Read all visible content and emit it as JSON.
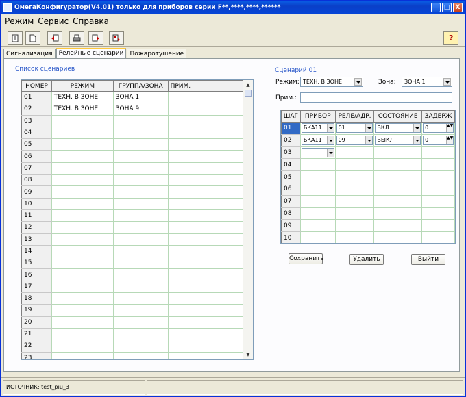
{
  "window": {
    "title": "ОмегаКонфигуратор(V4.01) только для приборов серии F**,****,****,******",
    "min_label": "_",
    "max_label": "□",
    "close_label": "X"
  },
  "menu": {
    "items": [
      "Режим",
      "Сервис",
      "Справка"
    ]
  },
  "toolbar": {
    "icons": [
      "new-doc-icon",
      "open-doc-icon",
      "import-icon",
      "print-icon",
      "export-icon",
      "export-alt-icon",
      "help-icon"
    ],
    "help_label": "?"
  },
  "tabs": [
    "Сигнализация",
    "Релейные сценарии",
    "Пожаротушение"
  ],
  "scenario_list": {
    "title": "Список сценариев",
    "columns": [
      "НОМЕР",
      "РЕЖИМ",
      "ГРУППА/ЗОНА",
      "ПРИМ."
    ],
    "rows": [
      [
        "01",
        "ТЕХН. В ЗОНЕ",
        "ЗОНА 1",
        ""
      ],
      [
        "02",
        "ТЕХН. В ЗОНЕ",
        "ЗОНА 9",
        ""
      ],
      [
        "03",
        "",
        "",
        ""
      ],
      [
        "04",
        "",
        "",
        ""
      ],
      [
        "05",
        "",
        "",
        ""
      ],
      [
        "06",
        "",
        "",
        ""
      ],
      [
        "07",
        "",
        "",
        ""
      ],
      [
        "08",
        "",
        "",
        ""
      ],
      [
        "09",
        "",
        "",
        ""
      ],
      [
        "10",
        "",
        "",
        ""
      ],
      [
        "11",
        "",
        "",
        ""
      ],
      [
        "12",
        "",
        "",
        ""
      ],
      [
        "13",
        "",
        "",
        ""
      ],
      [
        "14",
        "",
        "",
        ""
      ],
      [
        "15",
        "",
        "",
        ""
      ],
      [
        "16",
        "",
        "",
        ""
      ],
      [
        "17",
        "",
        "",
        ""
      ],
      [
        "18",
        "",
        "",
        ""
      ],
      [
        "19",
        "",
        "",
        ""
      ],
      [
        "20",
        "",
        "",
        ""
      ],
      [
        "21",
        "",
        "",
        ""
      ],
      [
        "22",
        "",
        "",
        ""
      ],
      [
        "23",
        "",
        "",
        ""
      ]
    ]
  },
  "scenario": {
    "title": "Сценарий 01",
    "mode_label": "Режим:",
    "mode_value": "ТЕХН. В ЗОНЕ",
    "zone_label": "Зона:",
    "zone_value": "ЗОНА 1",
    "note_label": "Прим.:",
    "note_value": "",
    "columns": [
      "ШАГ",
      "ПРИБОР",
      "РЕЛЕ/АДР.",
      "СОСТОЯНИЕ",
      "ЗАДЕРЖ"
    ],
    "steps": [
      {
        "step": "01",
        "device": "БКА11",
        "relay": "01",
        "state": "ВКЛ",
        "delay": "0"
      },
      {
        "step": "02",
        "device": "БКА11",
        "relay": "09",
        "state": "ВЫКЛ",
        "delay": "0"
      },
      {
        "step": "03",
        "device": "",
        "relay": "",
        "state": "",
        "delay": ""
      },
      {
        "step": "04",
        "device": "",
        "relay": "",
        "state": "",
        "delay": ""
      },
      {
        "step": "05",
        "device": "",
        "relay": "",
        "state": "",
        "delay": ""
      },
      {
        "step": "06",
        "device": "",
        "relay": "",
        "state": "",
        "delay": ""
      },
      {
        "step": "07",
        "device": "",
        "relay": "",
        "state": "",
        "delay": ""
      },
      {
        "step": "08",
        "device": "",
        "relay": "",
        "state": "",
        "delay": ""
      },
      {
        "step": "09",
        "device": "",
        "relay": "",
        "state": "",
        "delay": ""
      },
      {
        "step": "10",
        "device": "",
        "relay": "",
        "state": "",
        "delay": ""
      }
    ],
    "save_label": "Сохранить",
    "delete_label": "Удалить",
    "exit_label": "Выйти"
  },
  "status": {
    "source": "ИСТОЧНИК:  test_piu_3"
  },
  "colors": {
    "accent": "#0A5FE6",
    "group_title": "#2453C8",
    "selected_cell": "#316AC5",
    "grid_line": "#B7D9B7"
  }
}
